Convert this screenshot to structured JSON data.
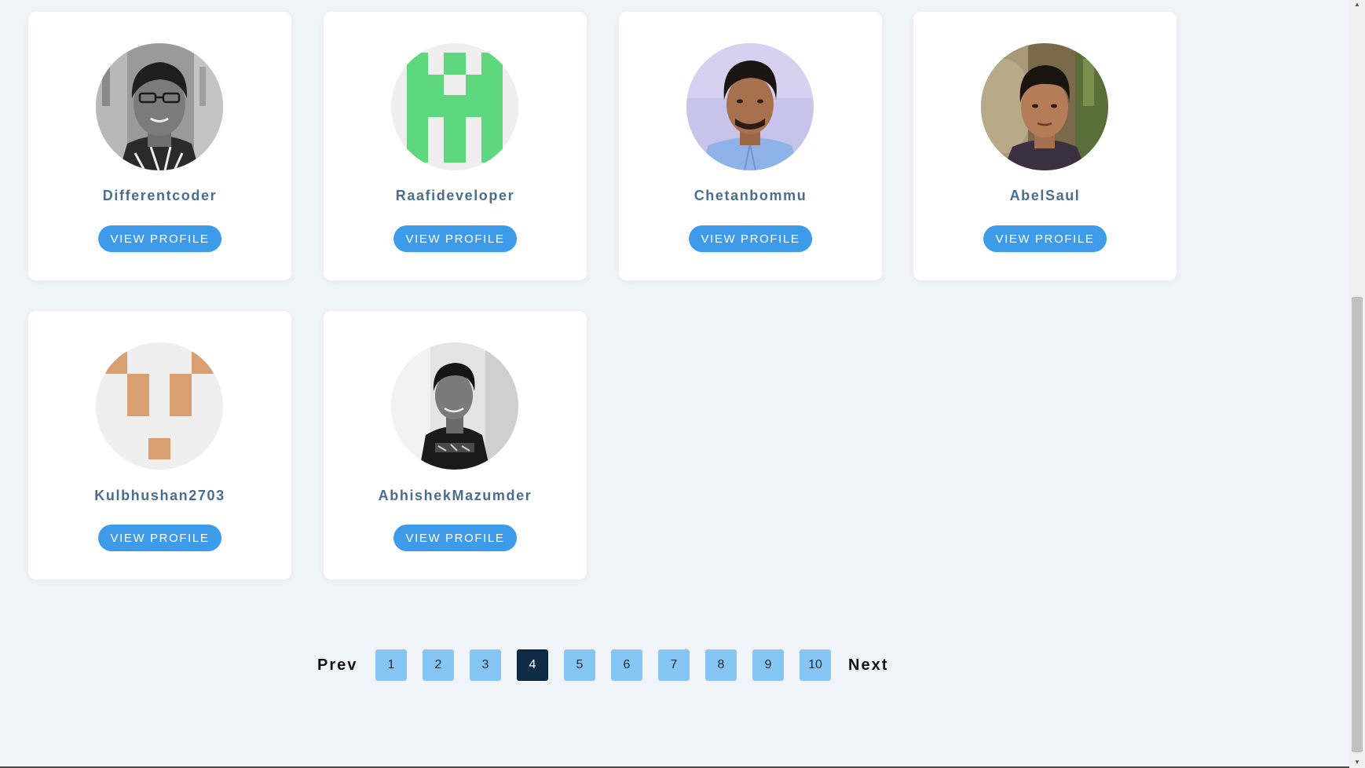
{
  "profiles": [
    {
      "name": "Differentcoder",
      "button_label": "VIEW PROFILE",
      "avatar_icon": "photo-man-glasses-icon"
    },
    {
      "name": "Raafideveloper",
      "button_label": "VIEW PROFILE",
      "avatar_icon": "identicon-green-icon"
    },
    {
      "name": "Chetanbommu",
      "button_label": "VIEW PROFILE",
      "avatar_icon": "photo-man-blue-shirt-icon"
    },
    {
      "name": "AbelSaul",
      "button_label": "VIEW PROFILE",
      "avatar_icon": "photo-man-rocks-icon"
    },
    {
      "name": "Kulbhushan2703",
      "button_label": "VIEW PROFILE",
      "avatar_icon": "identicon-tan-icon"
    },
    {
      "name": "AbhishekMazumder",
      "button_label": "VIEW PROFILE",
      "avatar_icon": "photo-man-hoodie-icon"
    }
  ],
  "pagination": {
    "prev_label": "Prev",
    "next_label": "Next",
    "pages": [
      "1",
      "2",
      "3",
      "4",
      "5",
      "6",
      "7",
      "8",
      "9",
      "10"
    ],
    "current_page": "4"
  },
  "colors": {
    "page_background": "#f0f4f8",
    "card_background": "#ffffff",
    "username_text": "#4a6d8e",
    "button_background": "#3d9be9",
    "page_button": "#86c6f5",
    "page_button_active": "#0f2c47"
  }
}
